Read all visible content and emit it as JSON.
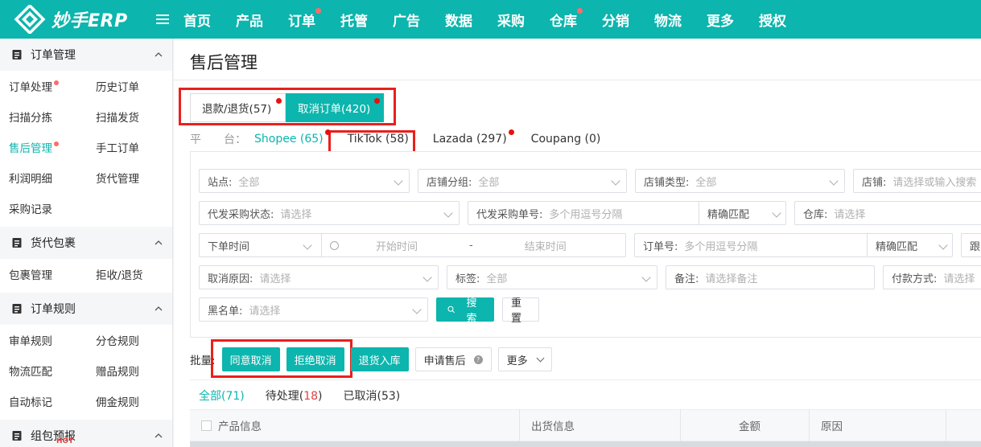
{
  "brand": {
    "logo_text": "妙手ERP"
  },
  "nav": {
    "items": [
      {
        "label": "首页",
        "dot": false
      },
      {
        "label": "产品",
        "dot": false
      },
      {
        "label": "订单",
        "dot": true
      },
      {
        "label": "托管",
        "dot": false
      },
      {
        "label": "广告",
        "dot": false
      },
      {
        "label": "数据",
        "dot": false
      },
      {
        "label": "采购",
        "dot": false
      },
      {
        "label": "仓库",
        "dot": true
      },
      {
        "label": "分销",
        "dot": false
      },
      {
        "label": "物流",
        "dot": false
      },
      {
        "label": "更多",
        "dot": false
      },
      {
        "label": "授权",
        "dot": false
      }
    ]
  },
  "sidebar": {
    "groups": [
      {
        "title": "订单管理",
        "items": [
          "订单处理",
          "历史订单",
          "扫描分拣",
          "扫描发货",
          "售后管理",
          "手工订单",
          "利润明细",
          "货代管理",
          "采购记录"
        ]
      },
      {
        "title": "货代包裹",
        "items": [
          "包裹管理",
          "拒收/退货"
        ]
      },
      {
        "title": "订单规则",
        "items": [
          "审单规则",
          "分仓规则",
          "物流匹配",
          "赠品规则",
          "自动标记",
          "佣金规则"
        ]
      },
      {
        "title": "组包预报",
        "items": []
      }
    ],
    "hot_badge": "HOT"
  },
  "page": {
    "title": "售后管理",
    "top_tabs": [
      {
        "label": "退款/退货(57)"
      },
      {
        "label": "取消订单(420)"
      }
    ],
    "platform": {
      "label": "平　　台：",
      "items": [
        "Shopee (65)",
        "TikTok (58)",
        "Lazada (297)",
        "Coupang (0)"
      ]
    },
    "filters": {
      "site": {
        "label": "站点:",
        "value": "全部"
      },
      "shop_group": {
        "label": "店铺分组:",
        "value": "全部"
      },
      "shop_type": {
        "label": "店铺类型:",
        "value": "全部"
      },
      "shop": {
        "label": "店铺:",
        "placeholder": "请选择或输入搜索"
      },
      "purchase_status": {
        "label": "代发采购状态:",
        "placeholder": "请选择"
      },
      "purchase_no": {
        "label": "代发采购单号:",
        "placeholder": "多个用逗号分隔",
        "match": "精确匹配"
      },
      "warehouse": {
        "label": "仓库:",
        "placeholder": "请选择"
      },
      "time": {
        "type": "下单时间",
        "start": "开始时间",
        "sep": "-",
        "end": "结束时间"
      },
      "order_no": {
        "label": "订单号:",
        "placeholder": "多个用逗号分隔",
        "match": "精确匹配"
      },
      "tracking": {
        "label": "跟"
      },
      "cancel_reason": {
        "label": "取消原因:",
        "placeholder": "请选择"
      },
      "tag": {
        "label": "标签:",
        "value": "全部"
      },
      "remark": {
        "label": "备注:",
        "placeholder": "请选择备注"
      },
      "payment": {
        "label": "付款方式:",
        "placeholder": "请选择"
      },
      "blacklist": {
        "label": "黑名单:",
        "placeholder": "请选择"
      },
      "search_label": "搜索",
      "reset_label": "重置"
    },
    "batch": {
      "label": "批量:",
      "agree": "同意取消",
      "reject": "拒绝取消",
      "return_stock": "退货入库",
      "apply_after_sale": "申请售后",
      "more": "更多"
    },
    "sub_tabs": {
      "all": "全部(71)",
      "pending_prefix": "待处理(",
      "pending_count": "18",
      "pending_suffix": ")",
      "cancelled": "已取消(53)"
    },
    "table_columns": [
      "产品信息",
      "出货信息",
      "金额",
      "原因"
    ]
  }
}
